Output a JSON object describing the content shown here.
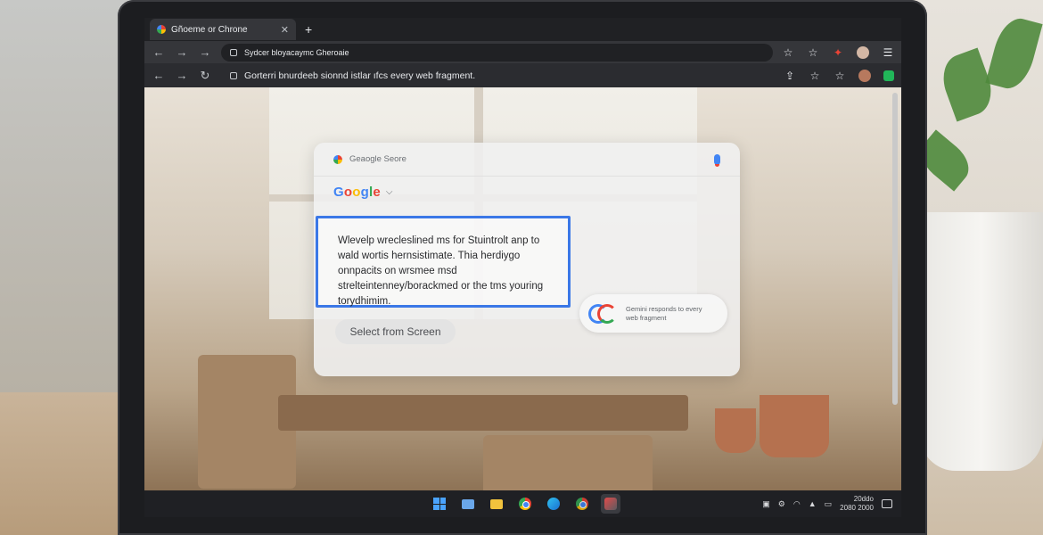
{
  "browser": {
    "tab_title": "Gñoeme or Chrone",
    "tab_close": "✕",
    "new_tab": "+",
    "url_top": "Sydcer bloyacaymc Gheroaie",
    "url_second": "Gorterri bnurdeeb sionnd istlar ıfcs every web fragment."
  },
  "search_card": {
    "placeholder": "Geaogle Seore",
    "brand": "Google",
    "selected_text": "Wlevelp wrecleslined ms for Stuintrolt anp to wald wortis hernsistimate. Thia herdiygo onnpacits on wrsmee msd strelteintenney/borackmed or the tms youring torydhimim.",
    "select_button": "Select from Screen",
    "gemini_text": "Gemini responds to every web fragment"
  },
  "taskbar": {
    "clock_time": "20ddo",
    "clock_date": "2080 2000"
  },
  "icons": {
    "back": "back-arrow-icon",
    "forward": "forward-arrow-icon",
    "reload": "reload-icon",
    "star": "star-icon",
    "menu": "kebab-menu-icon"
  },
  "colors": {
    "accent_blue": "#3b78e7",
    "chrome_bg": "#35363a",
    "taskbar_bg": "#1f2024"
  }
}
